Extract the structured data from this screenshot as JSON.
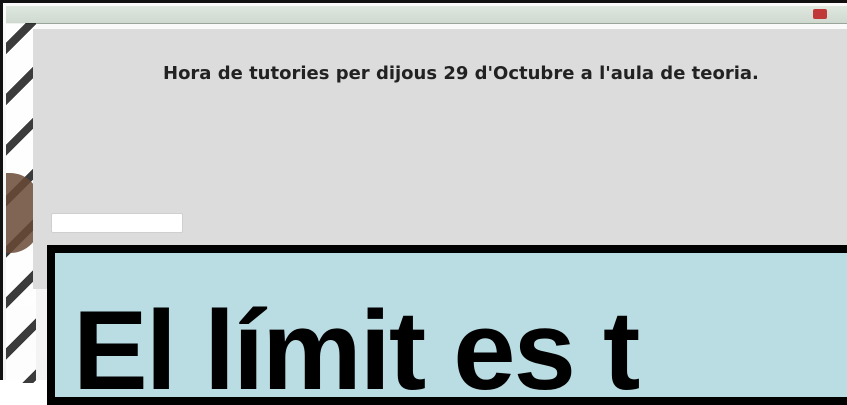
{
  "browser_bar": {
    "items": [
      "",
      "",
      "",
      ""
    ]
  },
  "form": {
    "title": "Hora de tutories per dijous 29 d'Octubre a l'aula de teoria.",
    "description_lines": [
      "",
      ""
    ],
    "required_note": "",
    "question_label": "",
    "answer_value": ""
  },
  "overlay": {
    "text": "El límit es t"
  },
  "colors": {
    "panel_bg": "#dcdcdc",
    "overlay_bg": "#b9dde3",
    "required_red": "#d04a4a"
  }
}
